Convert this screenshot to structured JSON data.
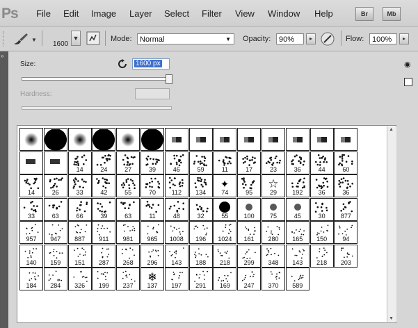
{
  "app": {
    "logo": "Ps"
  },
  "menus": [
    "File",
    "Edit",
    "Image",
    "Layer",
    "Select",
    "Filter",
    "View",
    "Window",
    "Help"
  ],
  "app_buttons": [
    "Br",
    "Mb"
  ],
  "options": {
    "brush_size": "1600",
    "mode_label": "Mode:",
    "mode_value": "Normal",
    "opacity_label": "Opacity:",
    "opacity_value": "90%",
    "flow_label": "Flow:",
    "flow_value": "100%"
  },
  "panel": {
    "size_label": "Size:",
    "size_value": "1600 px",
    "size_slider_pct": 100,
    "hardness_label": "Hardness:"
  },
  "presets": [
    [
      null,
      null,
      null,
      null,
      null,
      null,
      null,
      null,
      null,
      null,
      null,
      null,
      null,
      null
    ],
    [
      null,
      null,
      "14",
      "24",
      "27",
      "39",
      "46",
      "59",
      "11",
      "17",
      "23",
      "36",
      "44",
      "60"
    ],
    [
      "14",
      "26",
      "33",
      "42",
      "55",
      "70",
      "112",
      "134",
      "74",
      "95",
      "29",
      "192",
      "36",
      "36"
    ],
    [
      "33",
      "63",
      "66",
      "39",
      "63",
      "11",
      "48",
      "32",
      "55",
      "100",
      "75",
      "45",
      "30",
      "877"
    ],
    [
      "957",
      "947",
      "887",
      "911",
      "981",
      "965",
      "1008",
      "196",
      "1024",
      "161",
      "280",
      "165",
      "150",
      "94"
    ],
    [
      "140",
      "159",
      "151",
      "287",
      "268",
      "296",
      "143",
      "188",
      "218",
      "299",
      "348",
      "143",
      "218",
      "203"
    ],
    [
      "184",
      "284",
      "326",
      "199",
      "237",
      "137",
      "197",
      "291",
      "169",
      "247",
      "370",
      "589"
    ]
  ]
}
